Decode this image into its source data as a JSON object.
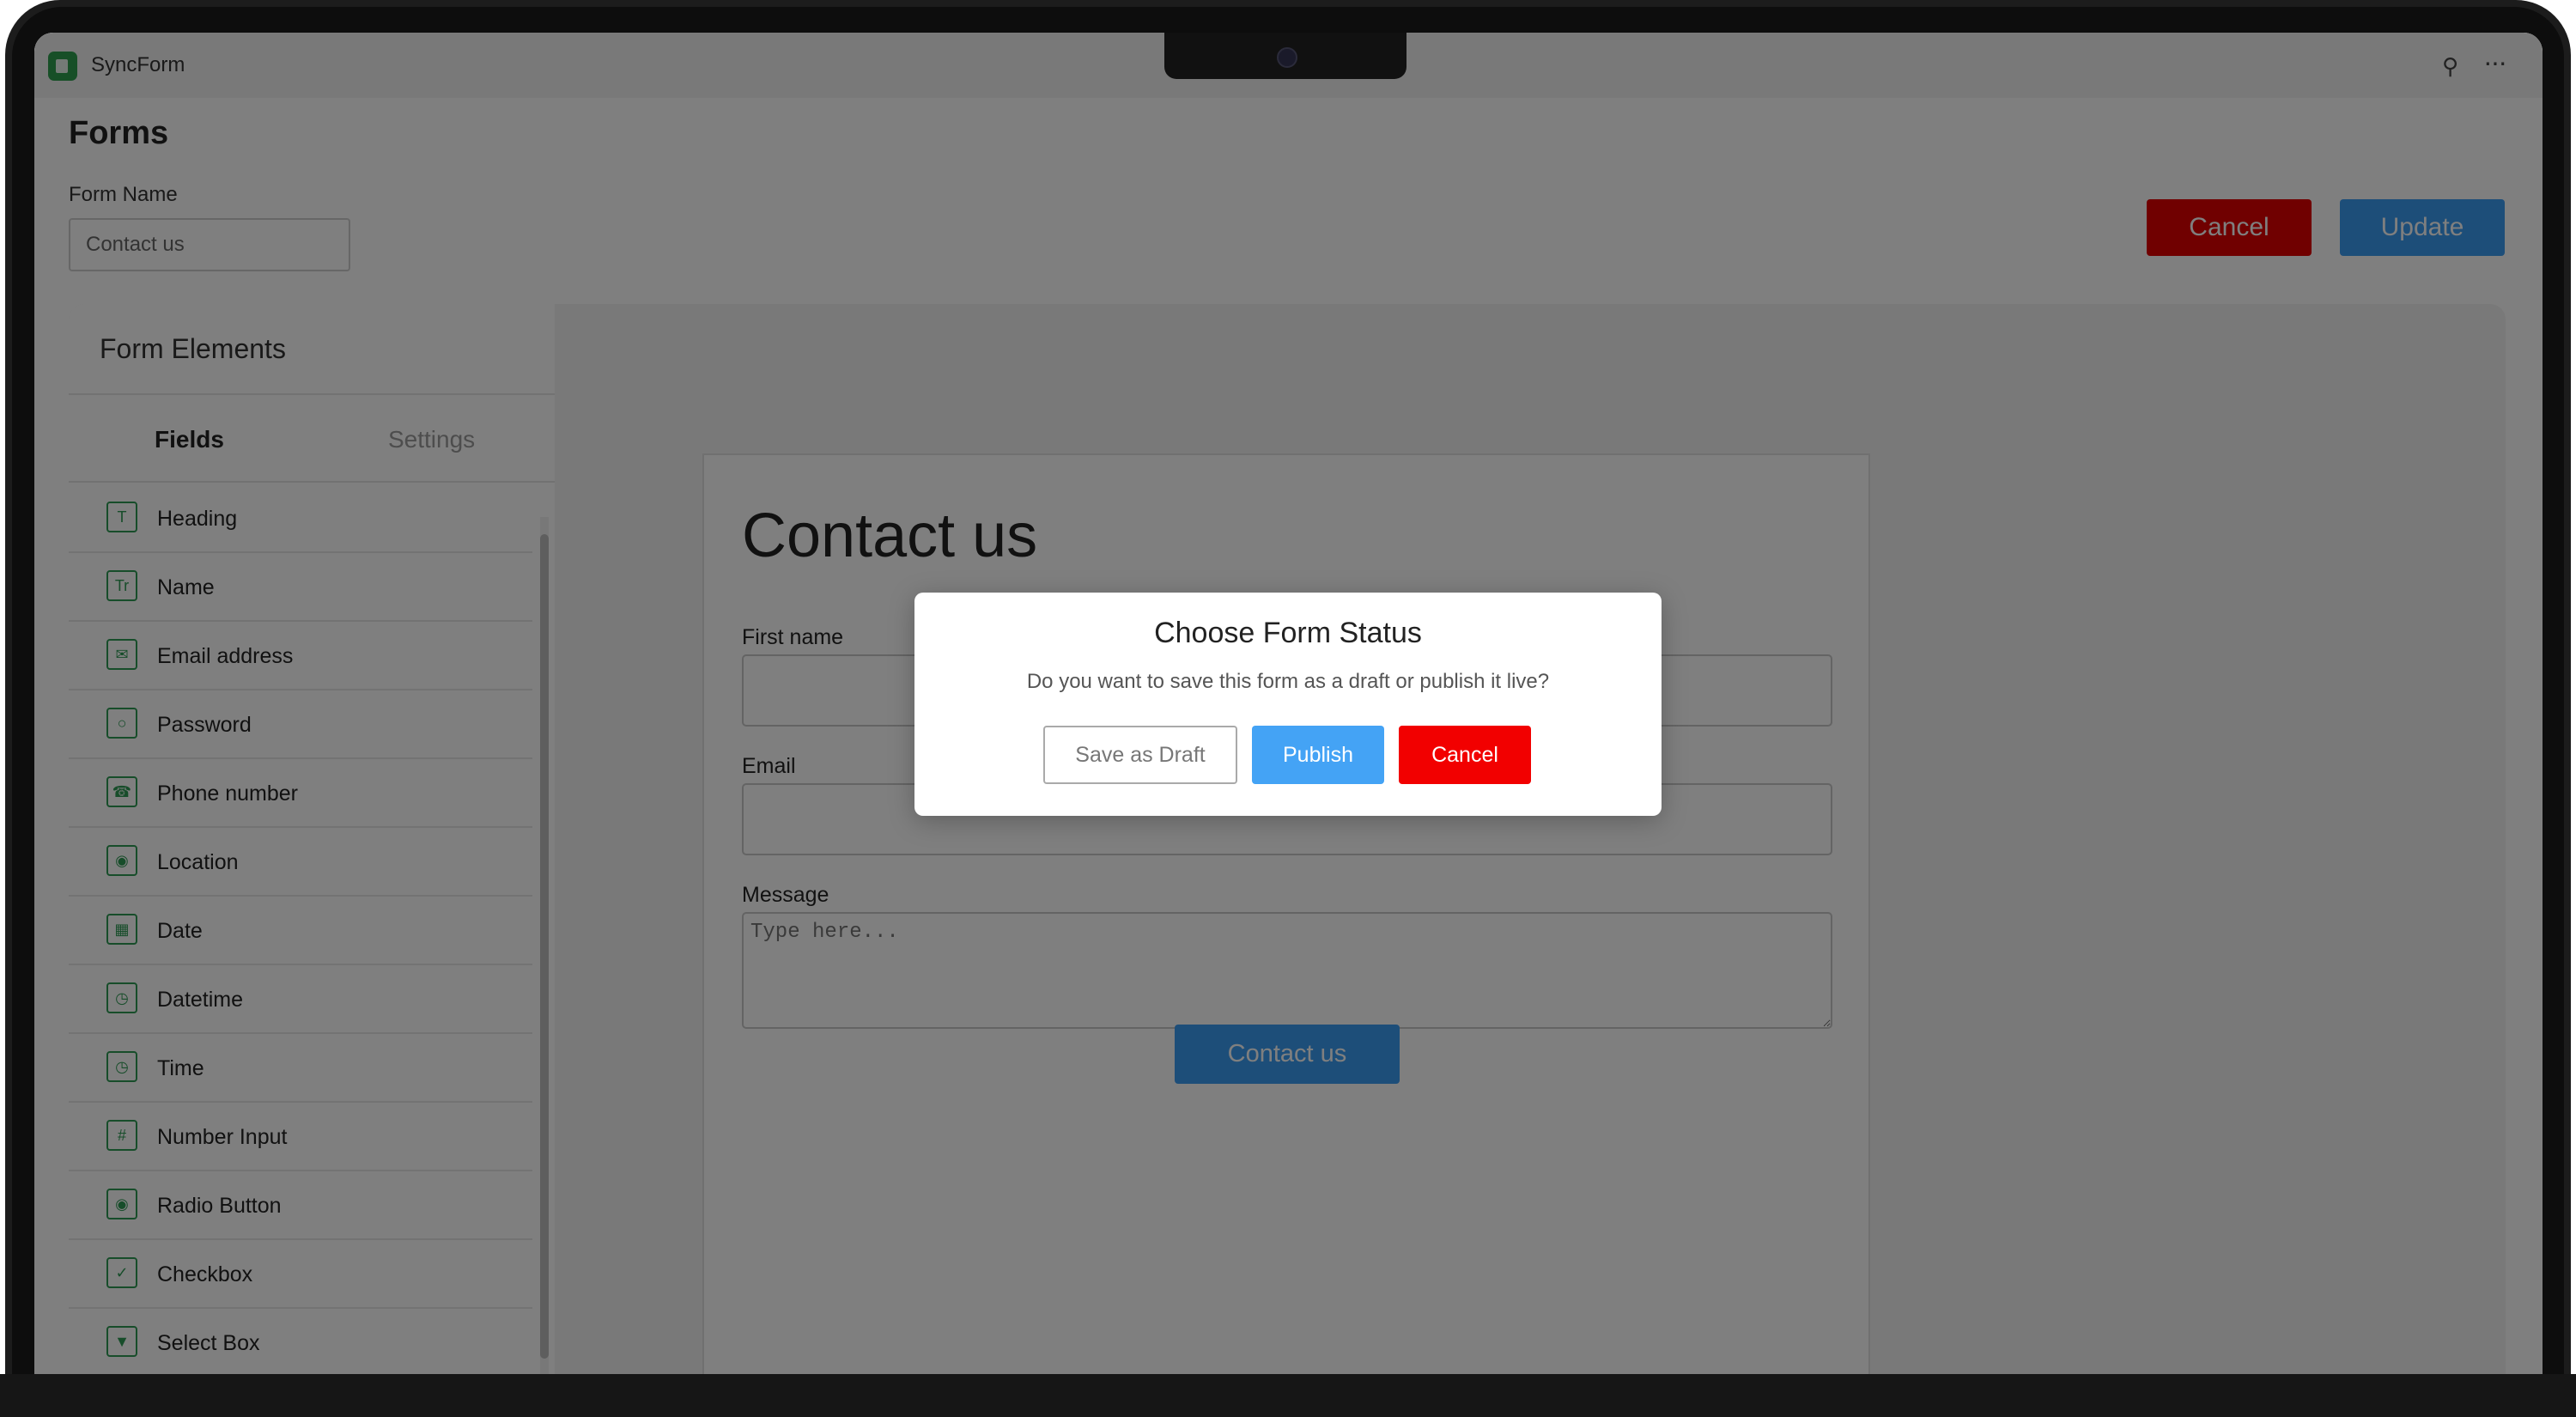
{
  "app": {
    "title": "SyncForm"
  },
  "page": {
    "title": "Forms"
  },
  "form_name": {
    "label": "Form Name",
    "value": "Contact us"
  },
  "top_actions": {
    "cancel_label": "Cancel",
    "update_label": "Update"
  },
  "sidebar": {
    "heading": "Form Elements",
    "tabs": [
      {
        "label": "Fields",
        "active": true
      },
      {
        "label": "Settings",
        "active": false
      }
    ],
    "items": [
      {
        "label": "Heading",
        "icon": "heading-icon"
      },
      {
        "label": "Name",
        "icon": "name-icon"
      },
      {
        "label": "Email address",
        "icon": "email-icon"
      },
      {
        "label": "Password",
        "icon": "lock-icon"
      },
      {
        "label": "Phone number",
        "icon": "phone-icon"
      },
      {
        "label": "Location",
        "icon": "location-icon"
      },
      {
        "label": "Date",
        "icon": "calendar-icon"
      },
      {
        "label": "Datetime",
        "icon": "clock-icon"
      },
      {
        "label": "Time",
        "icon": "clock-icon"
      },
      {
        "label": "Number Input",
        "icon": "number-icon"
      },
      {
        "label": "Radio Button",
        "icon": "radio-icon"
      },
      {
        "label": "Checkbox",
        "icon": "checkbox-icon"
      },
      {
        "label": "Select Box",
        "icon": "dropdown-icon"
      }
    ]
  },
  "preview": {
    "title": "Contact us",
    "fields": {
      "first_name": {
        "label": "First name",
        "value": ""
      },
      "email": {
        "label": "Email",
        "value": ""
      },
      "message": {
        "label": "Message",
        "placeholder": "Type here..."
      }
    },
    "submit_label": "Contact us"
  },
  "modal": {
    "title": "Choose Form Status",
    "text": "Do you want to save this form as a draft or publish it live?",
    "draft_label": "Save as Draft",
    "publish_label": "Publish",
    "cancel_label": "Cancel"
  },
  "colors": {
    "cancel": "#e00000",
    "primary": "#3b9cf2",
    "field_icon": "#2f9a55"
  }
}
